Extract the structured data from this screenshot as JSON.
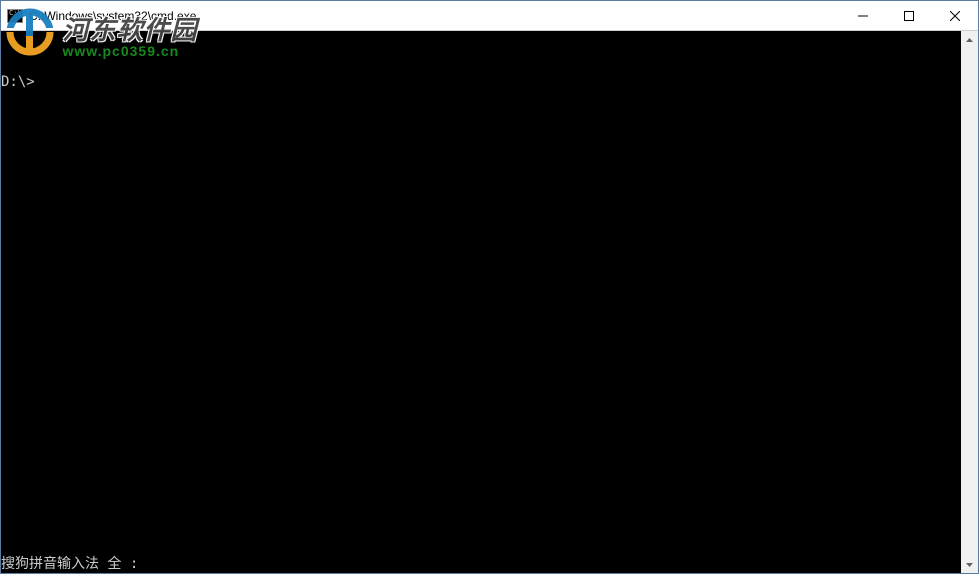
{
  "titlebar": {
    "title": "C:\\Windows\\system32\\cmd.exe"
  },
  "terminal": {
    "prompt": "D:\\>",
    "ime_status": "搜狗拼音输入法 全 :"
  },
  "watermark": {
    "cn_text": "河东软件园",
    "url_text": "www.pc0359.cn"
  }
}
